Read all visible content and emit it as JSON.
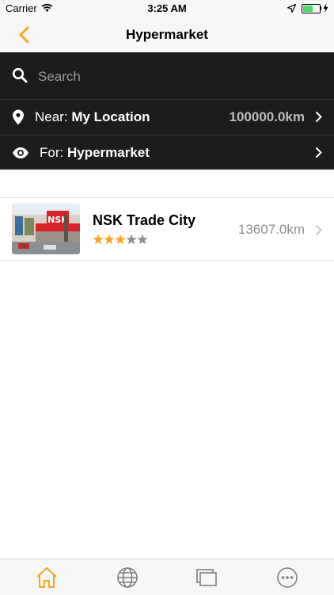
{
  "status_bar": {
    "carrier": "Carrier",
    "time": "3:25 AM"
  },
  "nav": {
    "title": "Hypermarket",
    "back_icon": "chevron-left-icon"
  },
  "filters": {
    "search_placeholder": "Search",
    "near_label": "Near:",
    "near_value": "My Location",
    "near_distance": "100000.0km",
    "for_label": "For:",
    "for_value": "Hypermarket"
  },
  "results": [
    {
      "name": "NSK Trade City",
      "rating": 3,
      "rating_max": 5,
      "distance": "13607.0km",
      "thumbnail_text": "NSK"
    }
  ],
  "tabs": [
    {
      "icon": "home-icon",
      "active": true
    },
    {
      "icon": "globe-icon",
      "active": false
    },
    {
      "icon": "gallery-icon",
      "active": false
    },
    {
      "icon": "more-icon",
      "active": false
    }
  ],
  "colors": {
    "accent": "#f5a623",
    "panel": "#1c1c1e",
    "star_on": "#f5a623",
    "star_off": "#8e8e93"
  }
}
